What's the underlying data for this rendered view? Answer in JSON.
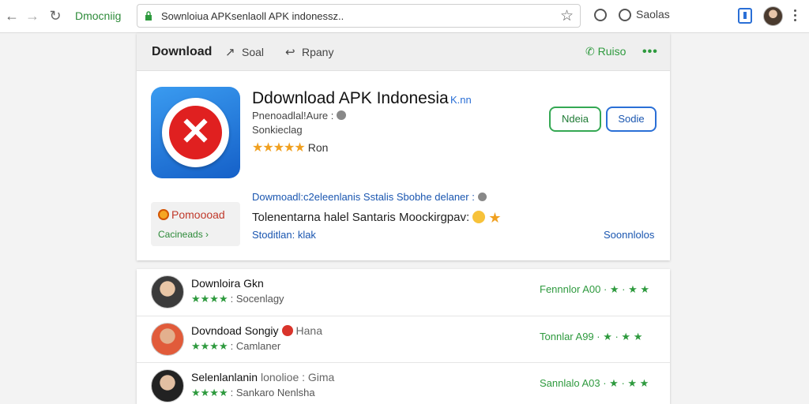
{
  "browser": {
    "tab_label": "Dmocniig",
    "url": "Sownloiua APKsenlaoll APK indonessz..",
    "right_label": "Saolas"
  },
  "header": {
    "title": "Download",
    "item1": "Soal",
    "item2": "Rpany",
    "right_link": "Ruiso"
  },
  "app": {
    "title": "Ddownload APK Indonesia",
    "tag": "K.nn",
    "developer": "Pnenoadlal!Aure :",
    "subtitle": "Sonkieclag",
    "rating_text": "Ron",
    "stars": "★★★★★",
    "button_primary": "Ndeia",
    "button_secondary": "Sodie"
  },
  "promo": {
    "label": "Pomoooad",
    "action": "Cacineads ›"
  },
  "details": {
    "links_line": "Dowmoadl:c2eleenlanis Sstalis Sbobhe delaner :",
    "description": "Tolenentarna halel Santaris Moockirgpav:",
    "more_link": "Stoditlan: klak",
    "right_link": "Soonnlolos"
  },
  "list": [
    {
      "title": "Downloira Gkn",
      "stars": "★★★★",
      "sub": ": Socenlagy",
      "extra": "",
      "right": "Fennnlor A00 · ★ · ★ ★"
    },
    {
      "title": "Dovndoad Songiy",
      "stars": "★★★★",
      "sub": ": Camlaner",
      "extra": "Hana",
      "right": "Tonnlar A99 · ★ · ★ ★"
    },
    {
      "title": "Selenlanlanin",
      "stars": "★★★★",
      "sub": ": Sankaro Nenlsha",
      "extra": "lonolioe : Gima",
      "right": "Sannlalo A03 · ★ · ★ ★"
    }
  ]
}
